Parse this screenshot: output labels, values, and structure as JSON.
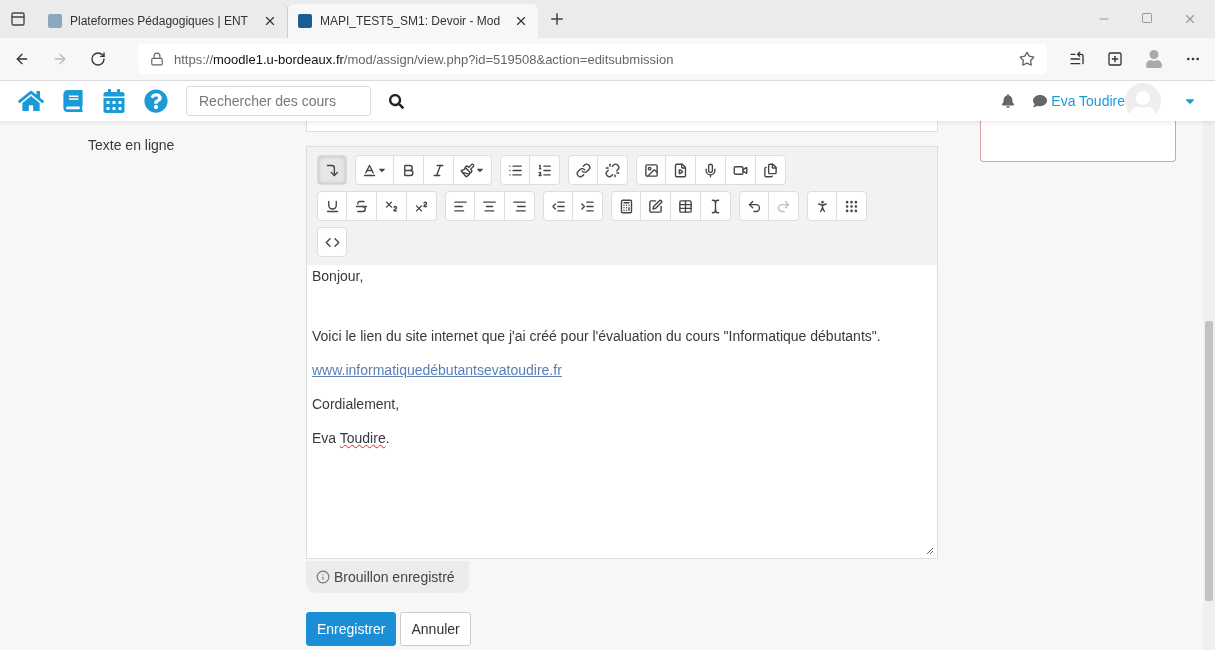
{
  "browser": {
    "tabs": [
      {
        "title": "Plateformes Pédagogiques | ENT",
        "selected": false
      },
      {
        "title": "MAPI_TEST5_SM1: Devoir - Mod",
        "selected": true
      }
    ],
    "address": {
      "scheme": "https://",
      "host": "moodle1.u-bordeaux.fr",
      "path": "/mod/assign/view.php?id=519508&action=editsubmission"
    }
  },
  "navbar": {
    "search": {
      "placeholder": "Rechercher des cours"
    },
    "user": "Eva Toudire"
  },
  "form": {
    "label": "Texte en ligne",
    "toolbar": {
      "more_pressed": true,
      "redo_disabled": true
    },
    "paragraphs": [
      {
        "kind": "text",
        "segments": [
          {
            "text": "Bonjour,",
            "misspelled": false
          }
        ]
      },
      {
        "kind": "text",
        "segments": [
          {
            "text": "Voici le lien du site internet que j'ai créé pour l'évaluation du cours \"Informatique débutants\".",
            "misspelled": false
          }
        ]
      },
      {
        "kind": "link",
        "segments": [
          {
            "text": "www.informatiquedébutantsevatoudire.fr",
            "misspelled": false
          }
        ]
      },
      {
        "kind": "text",
        "segments": [
          {
            "text": "Cordialement,",
            "misspelled": false
          }
        ]
      },
      {
        "kind": "text",
        "segments": [
          {
            "text": "Eva ",
            "misspelled": false
          },
          {
            "text": "Toudire",
            "misspelled": true
          },
          {
            "text": ".",
            "misspelled": false
          }
        ]
      }
    ],
    "draft_notice": "Brouillon enregistré",
    "buttons": [
      {
        "label": "Enregistrer",
        "kind": "primary"
      },
      {
        "label": "Annuler",
        "kind": "secondary"
      }
    ]
  }
}
